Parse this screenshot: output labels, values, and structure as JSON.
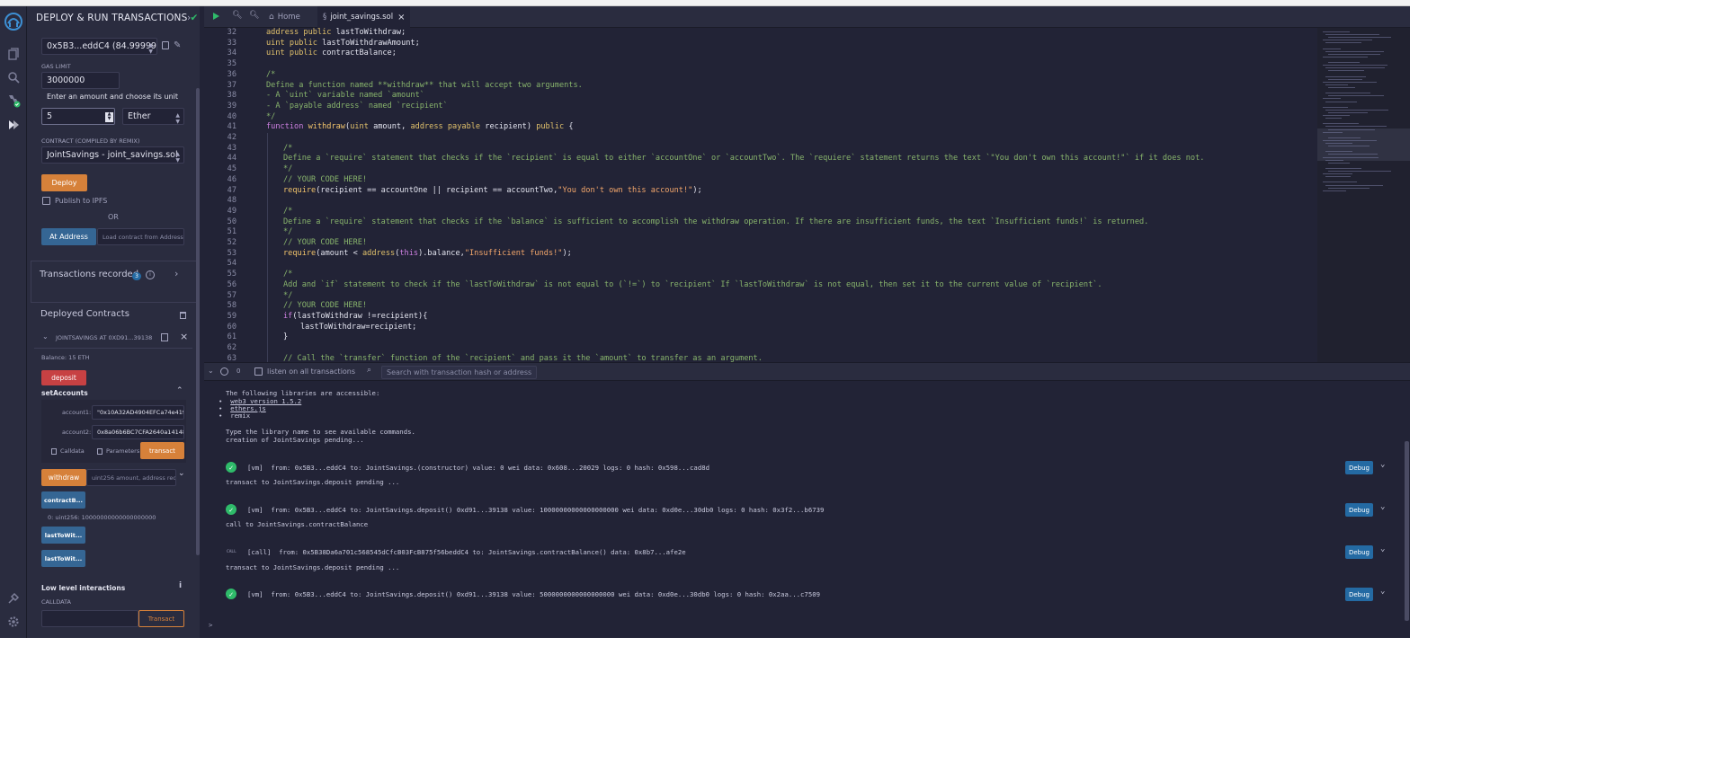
{
  "plugin": {
    "title": "DEPLOY & RUN TRANSACTIONS",
    "account_value": "0x5B3...eddC4 (84.999999",
    "gas_limit_label": "GAS LIMIT",
    "gas_limit_value": "3000000",
    "value_tooltip": "Enter an amount and choose its unit",
    "value_input": "5",
    "value_unit": "Ether",
    "contract_label": "CONTRACT (Compiled by Remix)",
    "contract_value": "JointSavings - joint_savings.sol",
    "deploy_label": "Deploy",
    "publish_ipfs_label": "Publish to IPFS",
    "or_label": "OR",
    "at_address_label": "At Address",
    "load_address_placeholder": "Load contract from Address",
    "transactions_recorded_label": "Transactions recorded",
    "transactions_recorded_count": "3",
    "deployed_contracts_label": "Deployed Contracts",
    "instance_name": "JOINTSAVINGS AT 0XD91...39138",
    "balance_text": "Balance: 15 ETH",
    "deposit_label": "deposit",
    "set_accounts_label": "setAccounts",
    "account1_label": "account1:",
    "account1_value": "\"0x10A32AD4904EFCa74e419f:",
    "account2_label": "account2:",
    "account2_value": "0x8a06b6BC7CFA2640a14148F",
    "calldata_label": "Calldata",
    "parameters_label": "Parameters",
    "transact_label": "transact",
    "withdraw_label": "withdraw",
    "withdraw_params": "uint256 amount, address recipi",
    "contract_balance_label": "contractB...",
    "contract_balance_result": "0: uint256: 10000000000000000000",
    "last_to_withdraw_label": "lastToWit...",
    "last_to_withdraw_amount_label": "lastToWit...",
    "low_level_label": "Low level interactions",
    "calldata_field_label": "CALLDATA",
    "transact_outline_label": "Transact"
  },
  "tabs": {
    "home": "Home",
    "file": "joint_savings.sol"
  },
  "editor": {
    "lines": [
      {
        "n": "32",
        "i": 0,
        "s": [
          [
            "c-kw",
            "address"
          ],
          [
            "",
            " "
          ],
          [
            "c-kw",
            "public"
          ],
          [
            "",
            " lastToWithdraw;"
          ]
        ]
      },
      {
        "n": "33",
        "i": 0,
        "s": [
          [
            "c-kw",
            "uint"
          ],
          [
            "",
            " "
          ],
          [
            "c-kw",
            "public"
          ],
          [
            "",
            " lastToWithdrawAmount;"
          ]
        ]
      },
      {
        "n": "34",
        "i": 0,
        "s": [
          [
            "c-kw",
            "uint"
          ],
          [
            "",
            " "
          ],
          [
            "c-kw",
            "public"
          ],
          [
            "",
            " contractBalance;"
          ]
        ]
      },
      {
        "n": "35",
        "i": 0,
        "s": []
      },
      {
        "n": "36",
        "i": 0,
        "s": [
          [
            "c-cm",
            "/*"
          ]
        ]
      },
      {
        "n": "37",
        "i": 0,
        "s": [
          [
            "c-cm",
            "Define a function named **withdraw** that will accept two arguments."
          ]
        ]
      },
      {
        "n": "38",
        "i": 0,
        "s": [
          [
            "c-cm",
            "- A `uint` variable named `amount`"
          ]
        ]
      },
      {
        "n": "39",
        "i": 0,
        "s": [
          [
            "c-cm",
            "- A `payable address` named `recipient`"
          ]
        ]
      },
      {
        "n": "40",
        "i": 0,
        "s": [
          [
            "c-cm",
            "*/"
          ]
        ]
      },
      {
        "n": "41",
        "i": 0,
        "s": [
          [
            "c-pur",
            "function"
          ],
          [
            "",
            " "
          ],
          [
            "c-fn",
            "withdraw"
          ],
          [
            "",
            "("
          ],
          [
            "c-kw",
            "uint"
          ],
          [
            "",
            " amount, "
          ],
          [
            "c-kw",
            "address"
          ],
          [
            "",
            " "
          ],
          [
            "c-kw",
            "payable"
          ],
          [
            "",
            " recipient) "
          ],
          [
            "c-kw",
            "public"
          ],
          [
            "",
            " {"
          ]
        ]
      },
      {
        "n": "42",
        "i": 0,
        "s": []
      },
      {
        "n": "43",
        "i": 1,
        "s": [
          [
            "c-cm",
            "/*"
          ]
        ]
      },
      {
        "n": "44",
        "i": 1,
        "s": [
          [
            "c-cm",
            "Define a `require` statement that checks if the `recipient` is equal to either `accountOne` or `accountTwo`. The `requiere` statement returns the text `\"You don't own this account!\"` if it does not."
          ]
        ]
      },
      {
        "n": "45",
        "i": 1,
        "s": [
          [
            "c-cm",
            "*/"
          ]
        ]
      },
      {
        "n": "46",
        "i": 1,
        "s": [
          [
            "c-cm",
            "// YOUR CODE HERE!"
          ]
        ]
      },
      {
        "n": "47",
        "i": 1,
        "s": [
          [
            "c-fn",
            "require"
          ],
          [
            "",
            "(recipient == accountOne || recipient == accountTwo,"
          ],
          [
            "c-str",
            "\"You don't own this account!\""
          ],
          [
            "",
            ");"
          ]
        ]
      },
      {
        "n": "48",
        "i": 0,
        "s": []
      },
      {
        "n": "49",
        "i": 1,
        "s": [
          [
            "c-cm",
            "/*"
          ]
        ]
      },
      {
        "n": "50",
        "i": 1,
        "s": [
          [
            "c-cm",
            "Define a `require` statement that checks if the `balance` is sufficient to accomplish the withdraw operation. If there are insufficient funds, the text `Insufficient funds!` is returned."
          ]
        ]
      },
      {
        "n": "51",
        "i": 1,
        "s": [
          [
            "c-cm",
            "*/"
          ]
        ]
      },
      {
        "n": "52",
        "i": 1,
        "s": [
          [
            "c-cm",
            "// YOUR CODE HERE!"
          ]
        ]
      },
      {
        "n": "53",
        "i": 1,
        "s": [
          [
            "c-fn",
            "require"
          ],
          [
            "",
            "(amount < "
          ],
          [
            "c-kw",
            "address"
          ],
          [
            "",
            "("
          ],
          [
            "c-pur",
            "this"
          ],
          [
            "",
            ").balance,"
          ],
          [
            "c-str",
            "\"Insufficient funds!\""
          ],
          [
            "",
            ");"
          ]
        ]
      },
      {
        "n": "54",
        "i": 0,
        "s": []
      },
      {
        "n": "55",
        "i": 1,
        "s": [
          [
            "c-cm",
            "/*"
          ]
        ]
      },
      {
        "n": "56",
        "i": 1,
        "s": [
          [
            "c-cm",
            "Add and `if` statement to check if the `lastToWithdraw` is not equal to (`!=`) to `recipient` If `lastToWithdraw` is not equal, then set it to the current value of `recipient`."
          ]
        ]
      },
      {
        "n": "57",
        "i": 1,
        "s": [
          [
            "c-cm",
            "*/"
          ]
        ]
      },
      {
        "n": "58",
        "i": 1,
        "s": [
          [
            "c-cm",
            "// YOUR CODE HERE!"
          ]
        ]
      },
      {
        "n": "59",
        "i": 1,
        "s": [
          [
            "c-pur",
            "if"
          ],
          [
            "",
            "(lastToWithdraw !=recipient){"
          ]
        ]
      },
      {
        "n": "60",
        "i": 2,
        "s": [
          [
            "",
            "lastToWithdraw=recipient;"
          ]
        ]
      },
      {
        "n": "61",
        "i": 1,
        "s": [
          [
            "",
            "}"
          ]
        ]
      },
      {
        "n": "62",
        "i": 0,
        "s": []
      },
      {
        "n": "63",
        "i": 1,
        "s": [
          [
            "c-cm",
            "// Call the `transfer` function of the `recipient` and pass it the `amount` to transfer as an argument."
          ]
        ]
      }
    ]
  },
  "terminal": {
    "count": "0",
    "listen_label": "listen on all transactions",
    "search_placeholder": "Search with transaction hash or address",
    "intro": "The following libraries are accessible:",
    "libs": [
      "web3 version 1.5.2",
      "ethers.js",
      "remix"
    ],
    "hint": "Type the library name to see available commands.",
    "pending1": "creation of JointSavings pending...",
    "tx1": "[vm]  from: 0x5B3...eddC4 to: JointSavings.(constructor) value: 0 wei data: 0x608...20029 logs: 0 hash: 0x598...cad8d",
    "pending2": "transact to JointSavings.deposit pending ...",
    "tx2": "[vm]  from: 0x5B3...eddC4 to: JointSavings.deposit() 0xd91...39138 value: 10000000000000000000 wei data: 0xd0e...30db0 logs: 0 hash: 0x3f2...b6739",
    "call_note": "call to JointSavings.contractBalance",
    "call_badge": "CALL",
    "tx3": "[call]  from: 0x5B38Da6a701c568545dCfcB03FcB875f56beddC4 to: JointSavings.contractBalance() data: 0x8b7...afe2e",
    "pending3": "transact to JointSavings.deposit pending ...",
    "tx4": "[vm]  from: 0x5B3...eddC4 to: JointSavings.deposit() 0xd91...39138 value: 5000000000000000000 wei data: 0xd0e...30db0 logs: 0 hash: 0x2aa...c7509",
    "debug_label": "Debug",
    "prompt": ">"
  },
  "colors": {
    "accent_orange": "#d6813a",
    "deposit_red": "#c74143",
    "call_blue": "#356694",
    "success_green": "#2fbb6a",
    "debug_blue": "#246aa3"
  },
  "icons": [
    "remix-logo-icon",
    "file-explorer-icon",
    "search-icon",
    "solidity-compiler-icon",
    "deploy-run-icon",
    "plugin-manager-icon",
    "settings-icon",
    "copy-icon",
    "edit-icon",
    "info-icon",
    "trash-icon",
    "close-icon",
    "run-icon",
    "zoom-out-icon",
    "zoom-in-icon",
    "home-icon"
  ]
}
